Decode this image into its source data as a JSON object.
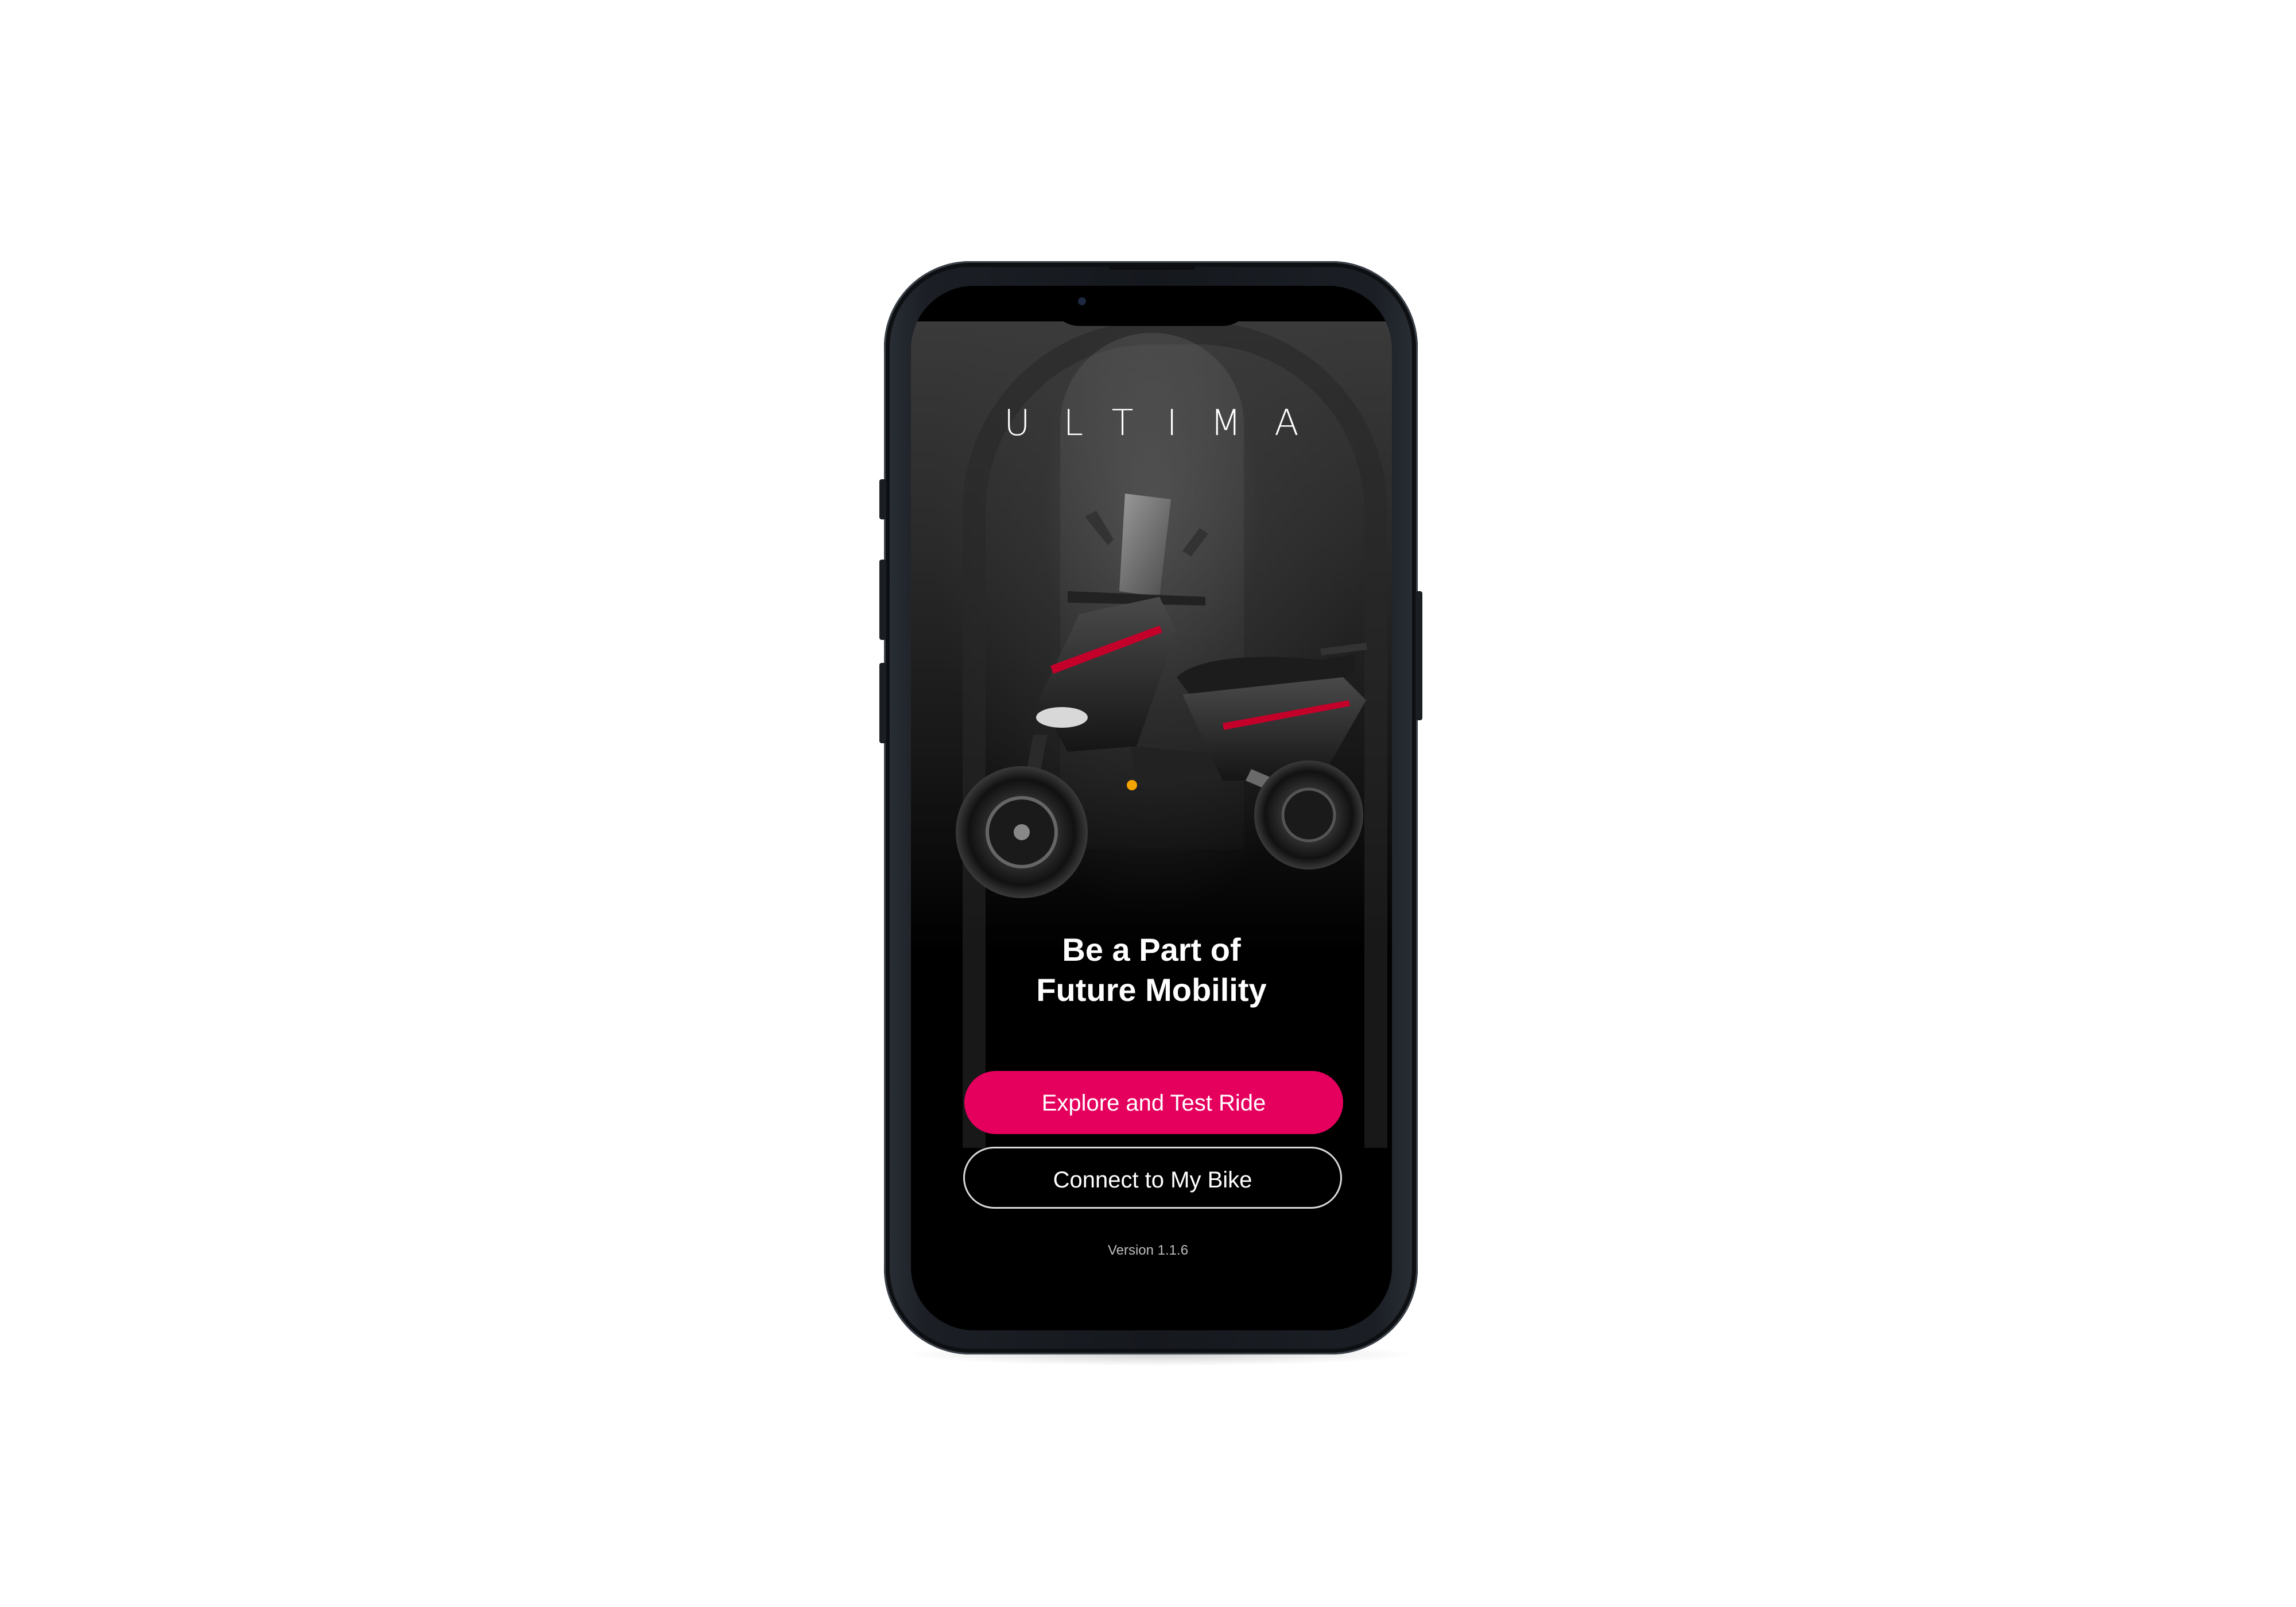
{
  "app": {
    "logo_text": "ULTIMA",
    "headline_line1": "Be a Part of",
    "headline_line2": "Future Mobility",
    "version": "Version 1.1.6"
  },
  "actions": {
    "primary_label": "Explore and Test Ride",
    "secondary_label": "Connect to My Bike"
  },
  "colors": {
    "accent": "#e5005e",
    "background": "#000000",
    "text": "#ffffff"
  }
}
